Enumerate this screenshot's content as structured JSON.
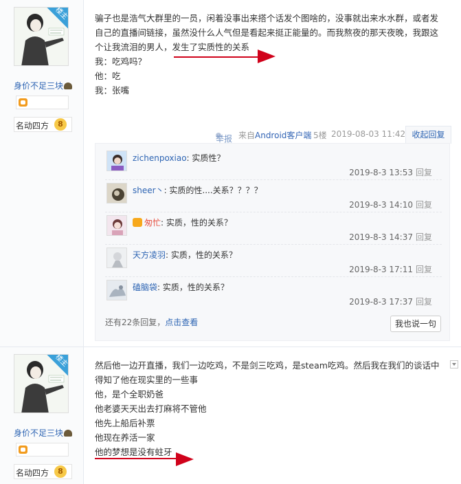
{
  "post1": {
    "user": {
      "name": "身价不足三块",
      "level_title": "名动四方",
      "level": "8",
      "badge": "楼主"
    },
    "lines": [
      "骗子也是浩气大群里的一员，闲着没事出来搭个话发个图啥的，没事就出来水水群，或者发",
      "自己的直播间链接，虽然没什么人气但是看起来挺正能量的。而我熬夜的那天夜晚，我跟这",
      "个让我流泪的男人，",
      "发生了实质性的关系",
      "我：吃鸡吗？",
      "他：吃",
      "我：张嘴"
    ],
    "tail": {
      "report": "举报",
      "from_prefix": "来自",
      "client": "Android客户端",
      "floor": "5楼",
      "date": "2019-08-03 11:42",
      "collapse": "收起回复"
    },
    "replies": [
      {
        "name": "zichenpoxiao",
        "text": ": 实质性？",
        "time": "2019-8-3 13:53",
        "reply": "回复"
      },
      {
        "name": "sheer丶",
        "text": ": 实质的性....关系？？？？",
        "time": "2019-8-3 14:10",
        "reply": "回复"
      },
      {
        "name": "匆忙",
        "text": ": 实质，性的关系？",
        "time": "2019-8-3 14:37",
        "reply": "回复"
      },
      {
        "name": "天方凌羽",
        "text": ": 实质，性的关系？",
        "time": "2019-8-3 17:11",
        "reply": "回复"
      },
      {
        "name": "磕脑袋",
        "text": ": 实质，性的关系？",
        "time": "2019-8-3 17:37",
        "reply": "回复"
      }
    ],
    "more_prefix": "还有22条回复，",
    "more_link": "点击查看",
    "say_button": "我也说一句"
  },
  "post2": {
    "user": {
      "name": "身价不足三块",
      "level_title": "名动四方",
      "level": "8",
      "badge": "楼主"
    },
    "lines": [
      "然后他一边开直播，我们一边吃鸡，不是剑三吃鸡，是steam吃鸡。然后我在我们的谈话中",
      "得知了他在现实里的一些事",
      "他，是个全职奶爸",
      "他老婆天天出去打麻将不管他",
      "他先上船后补票",
      "他现在养活一家",
      "他的梦想是没有蛀牙"
    ]
  },
  "colors": {
    "link": "#2d64b3",
    "annotation": "#d0021b",
    "badge": "#3aa0d9"
  }
}
